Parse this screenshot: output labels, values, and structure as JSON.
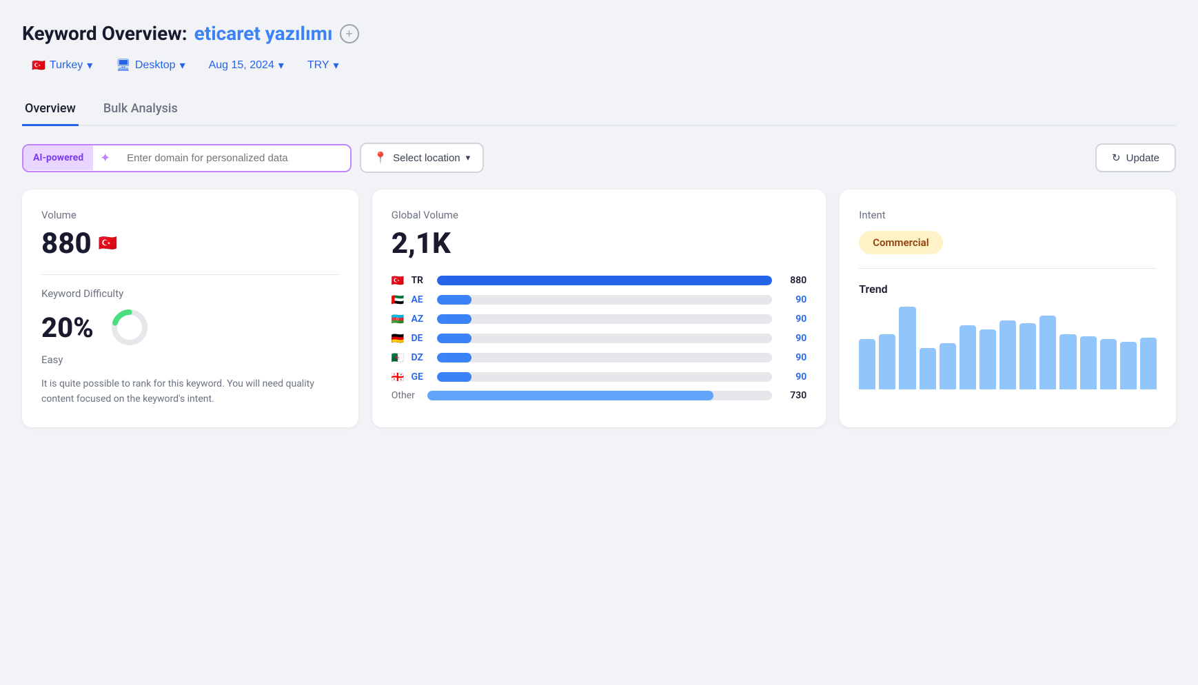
{
  "header": {
    "title_label": "Keyword Overview:",
    "keyword": "eticaret yazılımı",
    "add_icon_label": "+"
  },
  "filters": {
    "country": "Turkey",
    "country_flag": "🇹🇷",
    "device": "Desktop",
    "date": "Aug 15, 2024",
    "currency": "TRY",
    "chevron": "▾"
  },
  "tabs": [
    {
      "id": "overview",
      "label": "Overview",
      "active": true
    },
    {
      "id": "bulk-analysis",
      "label": "Bulk Analysis",
      "active": false
    }
  ],
  "ai_search": {
    "badge": "AI-powered",
    "placeholder": "Enter domain for personalized data",
    "select_location": "Select location",
    "update_label": "Update"
  },
  "volume_card": {
    "volume_label": "Volume",
    "volume_value": "880",
    "volume_flag": "🇹🇷",
    "kd_label": "Keyword Difficulty",
    "kd_value": "20%",
    "kd_rating": "Easy",
    "kd_description": "It is quite possible to rank for this keyword. You will need quality content focused on the keyword's intent."
  },
  "global_volume_card": {
    "label": "Global Volume",
    "value": "2,1K",
    "rows": [
      {
        "flag": "🇹🇷",
        "code": "TR",
        "value": 880,
        "max": 880,
        "display": "880",
        "color": "#2563eb",
        "is_blue": false
      },
      {
        "flag": "🇦🇪",
        "code": "AE",
        "value": 90,
        "max": 880,
        "display": "90",
        "color": "#3b82f6",
        "is_blue": true
      },
      {
        "flag": "🇦🇿",
        "code": "AZ",
        "value": 90,
        "max": 880,
        "display": "90",
        "color": "#3b82f6",
        "is_blue": true
      },
      {
        "flag": "🇩🇪",
        "code": "DE",
        "value": 90,
        "max": 880,
        "display": "90",
        "color": "#3b82f6",
        "is_blue": true
      },
      {
        "flag": "🇩🇿",
        "code": "DZ",
        "value": 90,
        "max": 880,
        "display": "90",
        "color": "#3b82f6",
        "is_blue": true
      },
      {
        "flag": "🇬🇪",
        "code": "GE",
        "value": 90,
        "max": 880,
        "display": "90",
        "color": "#3b82f6",
        "is_blue": true
      }
    ],
    "other_label": "Other",
    "other_value": 730,
    "other_display": "730",
    "other_color": "#60a5fa"
  },
  "intent_card": {
    "intent_label": "Intent",
    "intent_value": "Commercial",
    "trend_label": "Trend",
    "trend_bars": [
      55,
      60,
      90,
      45,
      50,
      70,
      65,
      75,
      72,
      80,
      60,
      58,
      55,
      52,
      56
    ]
  }
}
